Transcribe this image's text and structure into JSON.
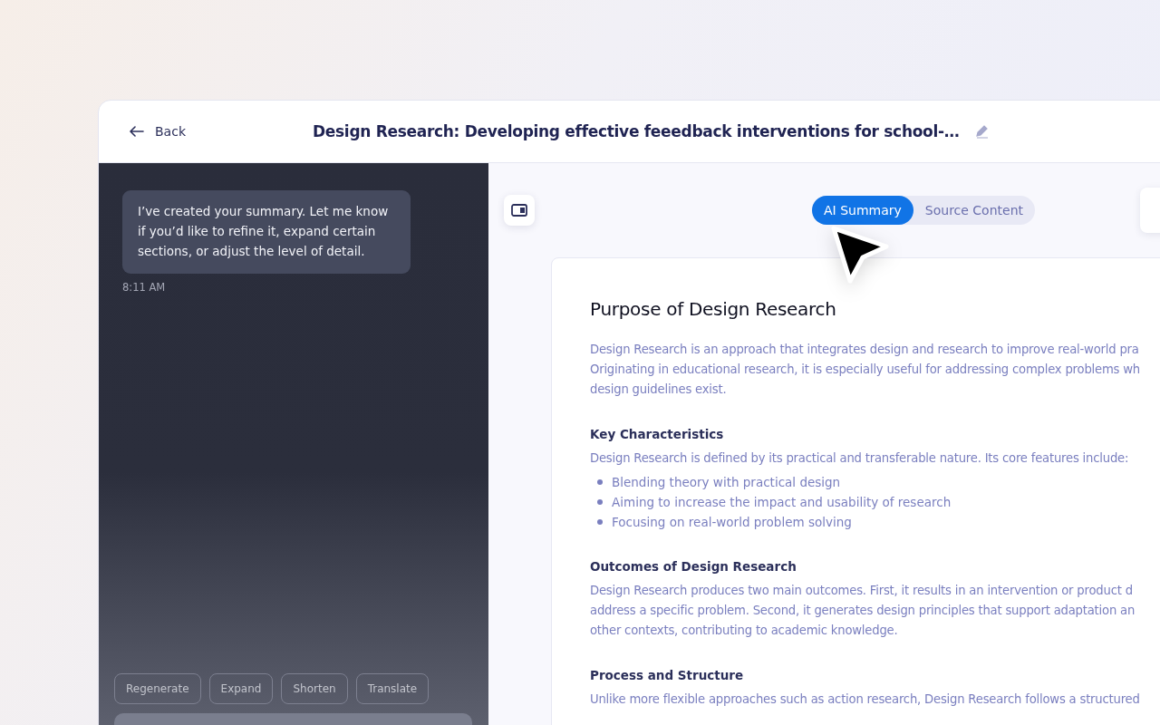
{
  "header": {
    "back": "Back",
    "title": "Design Research: Developing effective feeedback interventions for school-…"
  },
  "chat": {
    "message": "I’ve created your summary. Let me know if you’d like to refine it, expand certain sections, or adjust the level of detail.",
    "time": "8:11 AM",
    "actions": [
      "Regenerate",
      "Expand",
      "Shorten",
      "Translate"
    ]
  },
  "tabs": [
    {
      "label": "AI Summary",
      "selected": true
    },
    {
      "label": "Source Content",
      "selected": false
    }
  ],
  "document": {
    "title": "Purpose of Design Research",
    "sections": [
      {
        "lines": [
          "Design Research is an approach that integrates design and research to improve real-world pra",
          "Originating in educational research, it is especially useful for addressing complex problems wh",
          "design guidelines exist."
        ]
      },
      {
        "heading": "Key Characteristics",
        "lines": [
          "Design Research is defined by its practical and transferable nature. Its core features include:"
        ],
        "bullets": [
          "Blending theory with practical design",
          "Aiming to increase the impact and usability of research",
          "Focusing on real-world problem solving"
        ]
      },
      {
        "heading": "Outcomes of Design Research",
        "lines": [
          "Design Research produces two main outcomes. First, it results in an intervention or product d",
          "address a specific problem. Second, it generates design principles that support adaptation an",
          "other contexts, contributing to academic knowledge."
        ]
      },
      {
        "heading": "Process and Structure",
        "lines": [
          "Unlike more flexible approaches such as action research, Design Research follows a structured"
        ]
      }
    ]
  }
}
